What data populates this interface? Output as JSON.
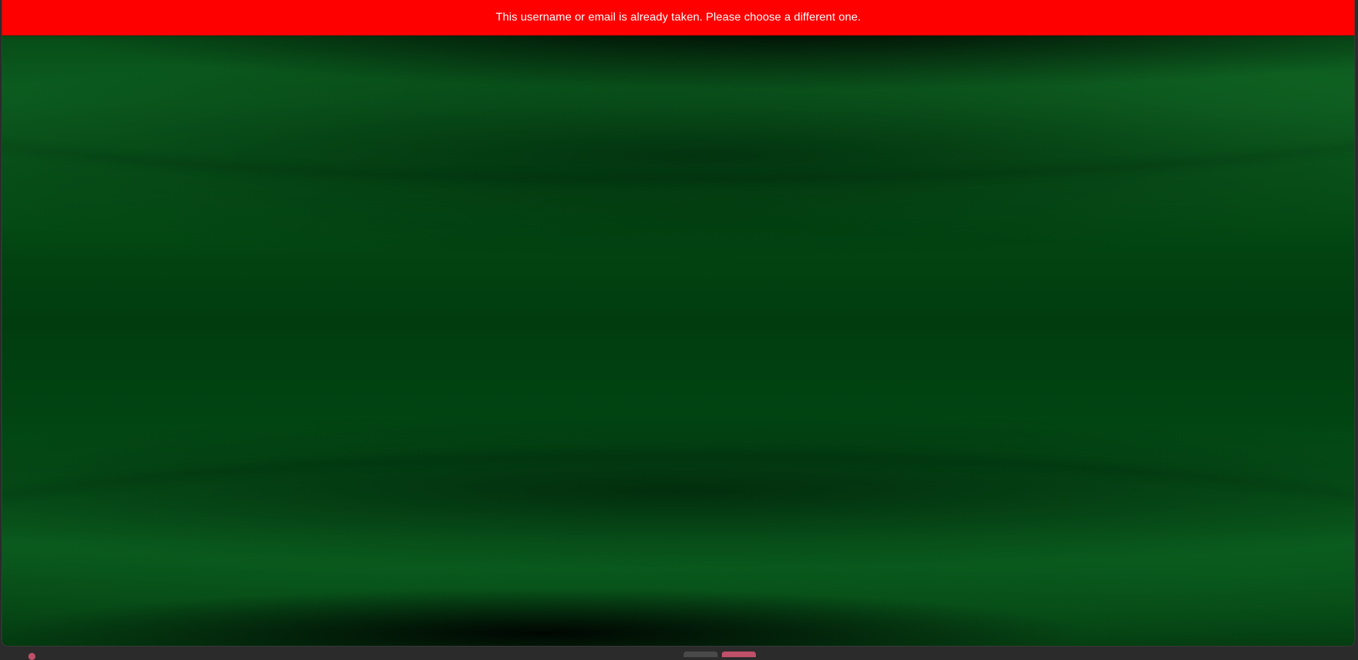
{
  "notification": {
    "message": "This username or email is already taken. Please choose a different one.",
    "background_color": "#ff0000",
    "text_color": "#ffffff"
  },
  "wallpaper": {
    "description_color": "#034a14"
  },
  "taskbar": {
    "items": [
      {
        "icon": "app-icon",
        "accent": "#c0506a"
      },
      {
        "icon": "window-button-icon",
        "accent": "#4a4a4a"
      },
      {
        "icon": "window-button-icon",
        "accent": "#c0506a"
      }
    ]
  }
}
